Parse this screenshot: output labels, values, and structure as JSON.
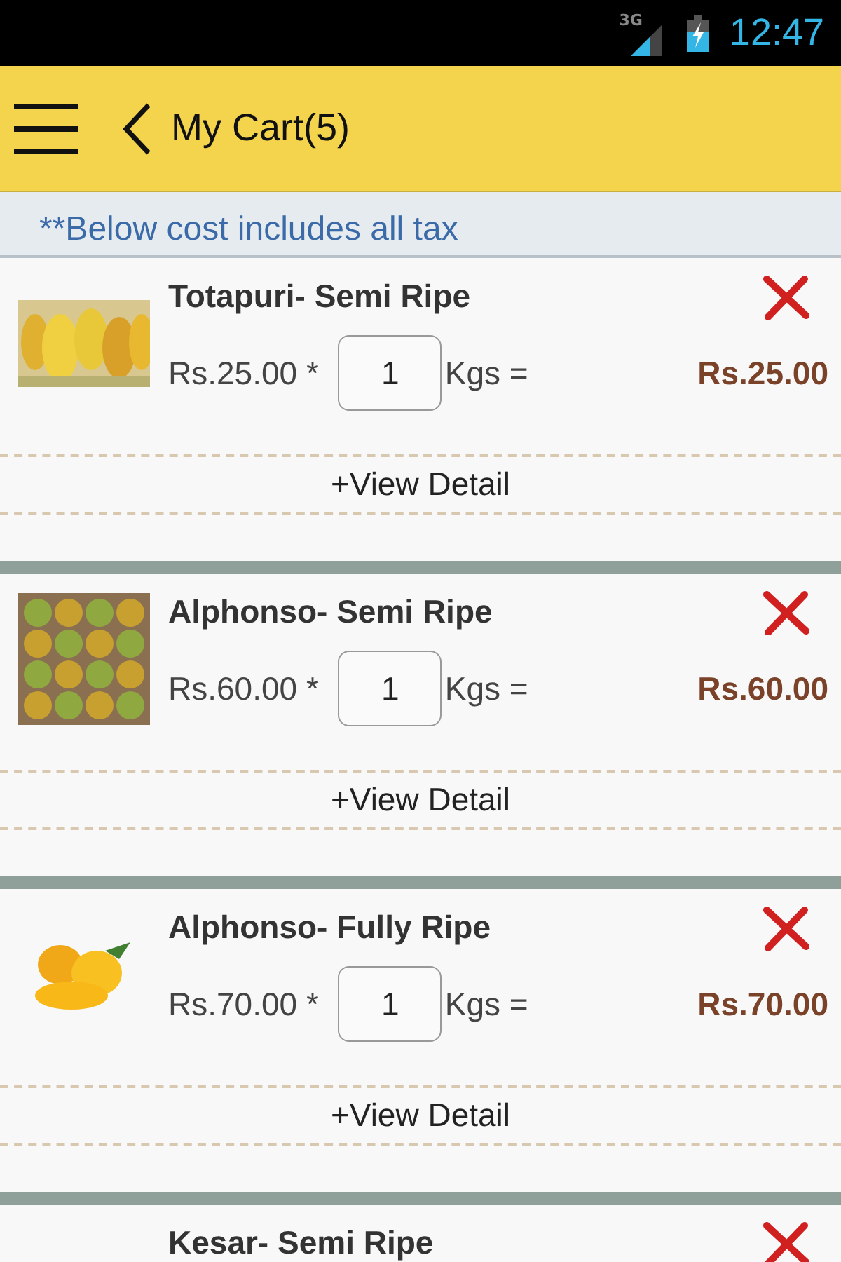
{
  "status_bar": {
    "network": "3G",
    "time": "12:47"
  },
  "header": {
    "title": "My Cart(5)"
  },
  "note": "**Below cost includes all tax",
  "items": [
    {
      "name": "Totapuri- Semi Ripe",
      "price": "Rs.25.00 *",
      "qty": "1",
      "unit": "Kgs =",
      "total": "Rs.25.00",
      "detail": "+View Detail"
    },
    {
      "name": "Alphonso- Semi Ripe",
      "price": "Rs.60.00 *",
      "qty": "1",
      "unit": "Kgs =",
      "total": "Rs.60.00",
      "detail": "+View Detail"
    },
    {
      "name": "Alphonso- Fully Ripe",
      "price": "Rs.70.00 *",
      "qty": "1",
      "unit": "Kgs =",
      "total": "Rs.70.00",
      "detail": "+View Detail"
    },
    {
      "name": "Kesar- Semi Ripe"
    }
  ]
}
